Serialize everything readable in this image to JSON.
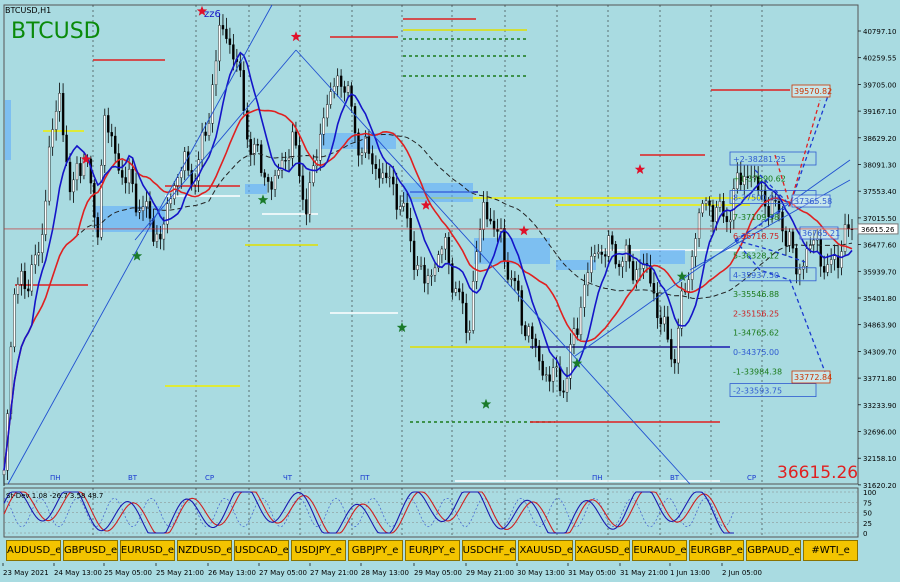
{
  "window": {
    "caption": "BTCUSD,H1"
  },
  "symbol_label": "BTCUSD",
  "zigzag_label": "zz6",
  "current_price": "36615.26",
  "current_price_tag": "36615.26",
  "price_axis": [
    "40797.10",
    "40259.55",
    "39705.00",
    "39167.10",
    "38629.20",
    "38091.30",
    "37553.40",
    "37015.50",
    "36477.60",
    "35939.70",
    "35401.80",
    "34863.90",
    "34309.70",
    "33771.80",
    "33233.90",
    "32696.00",
    "32158.10",
    "31620.20"
  ],
  "levels": [
    {
      "label": "+2-38281.25",
      "color": "#2f5bd1",
      "boxed": true
    },
    {
      "label": "+1-37890.62",
      "color": "#1a7a1a",
      "boxed": false
    },
    {
      "label": "8-37500.00",
      "color": "#2f5bd1",
      "boxed": true
    },
    {
      "label": "7-37109.38",
      "color": "#1a7a1a",
      "boxed": false
    },
    {
      "label": "6-36718.75",
      "color": "#cc2222",
      "boxed": false
    },
    {
      "label": "5-36328.12",
      "color": "#1a7a1a",
      "boxed": false
    },
    {
      "label": "4-35937.50",
      "color": "#2f5bd1",
      "boxed": true
    },
    {
      "label": "3-35546.88",
      "color": "#1a7a1a",
      "boxed": false
    },
    {
      "label": "2-35156.25",
      "color": "#cc2222",
      "boxed": false
    },
    {
      "label": "1-34765.62",
      "color": "#1a7a1a",
      "boxed": false
    },
    {
      "label": "0-34375.00",
      "color": "#2f5bd1",
      "boxed": false
    },
    {
      "label": "-1-33984.38",
      "color": "#1a7a1a",
      "boxed": false
    },
    {
      "label": "-2-33593.75",
      "color": "#2f5bd1",
      "boxed": true
    }
  ],
  "targets": {
    "upper": "39570.82",
    "middle": "37365.58",
    "near": "36765.21",
    "lower": "33772.84"
  },
  "weekday_labels": [
    "ПН",
    "ВТ",
    "СР",
    "ЧТ",
    "ПТ",
    "ПН",
    "ВТ",
    "СР"
  ],
  "time_axis": [
    "23 May 2021",
    "24 May 13:00",
    "25 May 05:00",
    "25 May 21:00",
    "26 May 13:00",
    "27 May 05:00",
    "27 May 21:00",
    "28 May 13:00",
    "29 May 05:00",
    "29 May 21:00",
    "30 May 13:00",
    "31 May 05:00",
    "31 May 21:00",
    "1 Jun 13:00",
    "2 Jun 05:00"
  ],
  "oscillator": {
    "label": "St-Dev 1.08 -26.7 3.58 48.7",
    "levels": [
      "100",
      "75",
      "50",
      "25",
      "0"
    ]
  },
  "symbols": [
    "AUDUSD_e",
    "GBPUSD_e",
    "EURUSD_e",
    "NZDUSD_e",
    "USDCAD_e",
    "USDJPY_e",
    "GBPJPY_e",
    "EURJPY_e",
    "USDCHF_e",
    "XAUUSD_e",
    "XAGUSD_e",
    "EURAUD_e",
    "EURGBP_e",
    "GBPAUD_e",
    "#WTI_e"
  ],
  "colors": {
    "background": "#a9dbe1",
    "ma_fast": "#1414c8",
    "ma_slow": "#e02020",
    "ma_long": "#222222",
    "bull": "#ffffff",
    "bear": "#000000",
    "button": "#f3c400",
    "peak_marker": "#e0102a",
    "trough_marker": "#1a7a2a"
  },
  "chart_data": {
    "type": "candlestick",
    "title": "BTCUSD,H1",
    "ylim": [
      31620.2,
      41000
    ],
    "current_price": 36615.26,
    "close_path": [
      {
        "t": 0,
        "p": 31800
      },
      {
        "t": 8,
        "p": 35300
      },
      {
        "t": 30,
        "p": 36000
      },
      {
        "t": 40,
        "p": 38300
      },
      {
        "t": 48,
        "p": 39200
      },
      {
        "t": 58,
        "p": 37200
      },
      {
        "t": 70,
        "p": 38300
      },
      {
        "t": 80,
        "p": 36300
      },
      {
        "t": 86,
        "p": 38800
      },
      {
        "t": 100,
        "p": 37800
      },
      {
        "t": 120,
        "p": 37000
      },
      {
        "t": 135,
        "p": 36400
      },
      {
        "t": 150,
        "p": 37800
      },
      {
        "t": 166,
        "p": 37700
      },
      {
        "t": 176,
        "p": 38700
      },
      {
        "t": 186,
        "p": 40500
      },
      {
        "t": 198,
        "p": 40200
      },
      {
        "t": 212,
        "p": 38300
      },
      {
        "t": 232,
        "p": 37400
      },
      {
        "t": 248,
        "p": 38400
      },
      {
        "t": 262,
        "p": 37000
      },
      {
        "t": 276,
        "p": 38900
      },
      {
        "t": 292,
        "p": 39700
      },
      {
        "t": 304,
        "p": 38400
      },
      {
        "t": 322,
        "p": 37800
      },
      {
        "t": 340,
        "p": 37300
      },
      {
        "t": 362,
        "p": 35500
      },
      {
        "t": 380,
        "p": 36300
      },
      {
        "t": 400,
        "p": 34600
      },
      {
        "t": 414,
        "p": 37100
      },
      {
        "t": 430,
        "p": 36300
      },
      {
        "t": 446,
        "p": 35000
      },
      {
        "t": 466,
        "p": 33800
      },
      {
        "t": 485,
        "p": 33600
      },
      {
        "t": 498,
        "p": 35200
      },
      {
        "t": 510,
        "p": 36200
      },
      {
        "t": 524,
        "p": 36200
      },
      {
        "t": 540,
        "p": 35900
      },
      {
        "t": 556,
        "p": 35800
      },
      {
        "t": 568,
        "p": 34700
      },
      {
        "t": 578,
        "p": 34100
      },
      {
        "t": 590,
        "p": 35700
      },
      {
        "t": 604,
        "p": 37200
      },
      {
        "t": 622,
        "p": 36800
      },
      {
        "t": 640,
        "p": 37800
      },
      {
        "t": 656,
        "p": 37200
      },
      {
        "t": 672,
        "p": 36800
      },
      {
        "t": 684,
        "p": 35800
      },
      {
        "t": 700,
        "p": 36400
      },
      {
        "t": 712,
        "p": 35700
      },
      {
        "t": 722,
        "p": 36300
      },
      {
        "t": 732,
        "p": 36615
      }
    ],
    "fractal_highs": [
      37900,
      40800,
      40300,
      37000,
      36500,
      37700
    ],
    "fractal_lows": [
      36200,
      37300,
      34800,
      33300,
      34100,
      35800
    ],
    "targets": [
      39570.82,
      37365.58,
      36765.21,
      33772.84
    ]
  }
}
